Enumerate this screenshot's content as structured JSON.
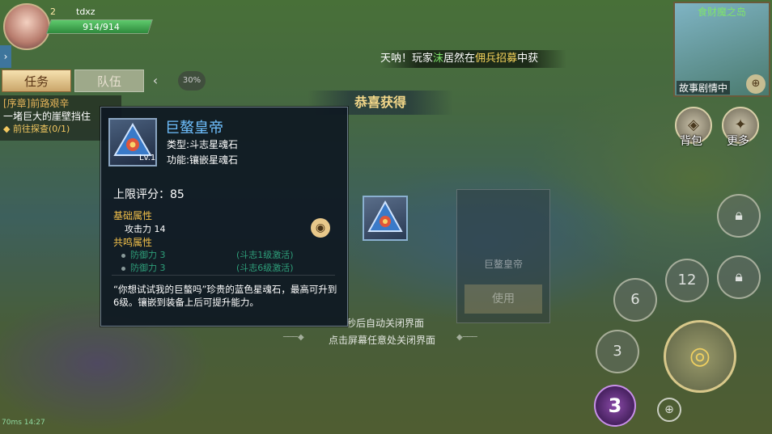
{
  "player": {
    "level": "2",
    "name": "tdxz",
    "hp": "914/914",
    "hp_fraction": 1.0
  },
  "tabs": {
    "task": "任务",
    "team": "队伍",
    "collapse_icon": "chevron-left-icon"
  },
  "percent_badge": "30%",
  "quest": {
    "title": "[序章]前路艰辛",
    "desc": "一堵巨大的崖壁挡住",
    "action": "◆ 前往探查(0/1)"
  },
  "broadcast": {
    "part1": "天呐！玩家",
    "player": "沫",
    "part2": "居然在",
    "place": "佣兵招募",
    "part3": "中获"
  },
  "minimap": {
    "title": "食财魔之岛",
    "status": "故事剧情中"
  },
  "right_buttons": {
    "bag": "背包",
    "more": "更多"
  },
  "skills": {
    "lock_a": "",
    "lock_12": "12",
    "s6": "6",
    "s3": "3",
    "charge": "3"
  },
  "reward": {
    "title": "恭喜获得",
    "ghost_name": "巨鳌皇帝",
    "ghost_button": "使用",
    "auto_close": "秒后自动关闭界面",
    "tap_close": "点击屏幕任意处关闭界面"
  },
  "tooltip": {
    "name": "巨螯皇帝",
    "level": "Lv.1",
    "type": "类型:斗志星魂石",
    "function": "功能:镶嵌星魂石",
    "score_label": "上限评分：",
    "score": "85",
    "base_section": "基础属性",
    "base_attr": "攻击力 14",
    "resonance_section": "共鸣属性",
    "resonance": [
      {
        "attr": "防御力 3",
        "req": "(斗志1级激活)"
      },
      {
        "attr": "防御力 3",
        "req": "(斗志6级激活)"
      }
    ],
    "description": "“你想试试我的巨螯吗”珍贵的蓝色星魂石，最高可升到6级。镶嵌到装备上后可提升能力。"
  },
  "status_bar": "70ms 14:27",
  "colors": {
    "tooltip_name": "#6fc0ff",
    "section": "#f2c04a",
    "resonance": "#2e9f7a",
    "hp": "#5fcb6d"
  }
}
